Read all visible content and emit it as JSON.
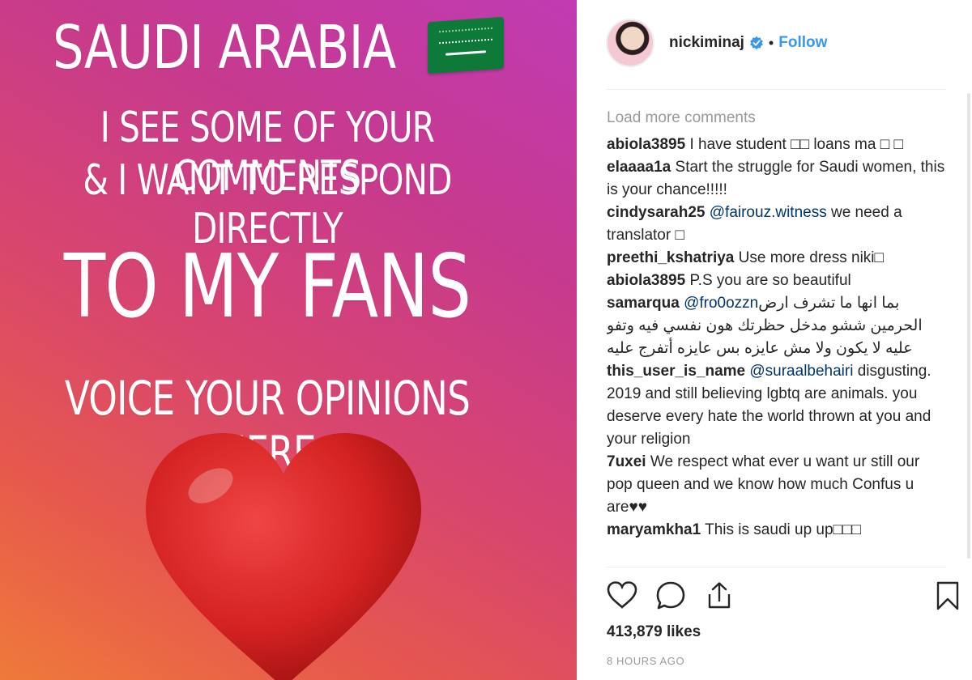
{
  "post_image": {
    "line1": "SAUDI ARABIA",
    "line2": "I SEE SOME OF YOUR COMMENTS",
    "line3": "& I WANT TO RESPOND DIRECTLY",
    "line4": "TO MY FANS",
    "line5": "VOICE YOUR OPINIONS HERE",
    "flag_icon": "saudi-flag-emoji",
    "heart_icon": "red-heart-emoji"
  },
  "header": {
    "username": "nickiminaj",
    "separator": "•",
    "follow_label": "Follow"
  },
  "comments": {
    "load_more": "Load more comments",
    "items": [
      {
        "user": "abiola3895",
        "text": " I have student □□ loans ma □ □"
      },
      {
        "user": "elaaaa1a",
        "text": " Start the struggle for Saudi women, this is your chance!!!!!"
      },
      {
        "user": "cindysarah25",
        "mention": "@fairouz.witness",
        "text": " we need a translator □"
      },
      {
        "user": "preethi_kshatriya",
        "text": " Use more dress niki□"
      },
      {
        "user": "abiola3895",
        "text": " P.S you are so beautiful"
      },
      {
        "user": "samarqua",
        "mention": "@fro0ozzn",
        "text": " بما انها ما تشرف ارض الحرمين ششو مدخل حظرتك هون نفسي فيه وتفو عليه لا يكون ولا مش عايزه بس عايزه أتفرج عليه"
      },
      {
        "user": "this_user_is_name",
        "mention": "@suraalbehairi",
        "text": " disgusting. 2019 and still believing lgbtq are animals. you deserve every hate the world thrown at you and your religion"
      },
      {
        "user": "7uxei",
        "text": " We respect what ever u want ur still our pop queen and we know how much Confus u are♥♥"
      },
      {
        "user": "maryamkha1",
        "text": " This is saudi up up□□□"
      }
    ]
  },
  "actions": {
    "like_icon": "heart-outline-icon",
    "comment_icon": "comment-bubble-icon",
    "share_icon": "share-icon",
    "save_icon": "bookmark-icon"
  },
  "likes": "413,879 likes",
  "time": "8 HOURS AGO",
  "colors": {
    "link_blue": "#3897f0",
    "mention_blue": "#003569",
    "muted_gray": "#999999"
  }
}
